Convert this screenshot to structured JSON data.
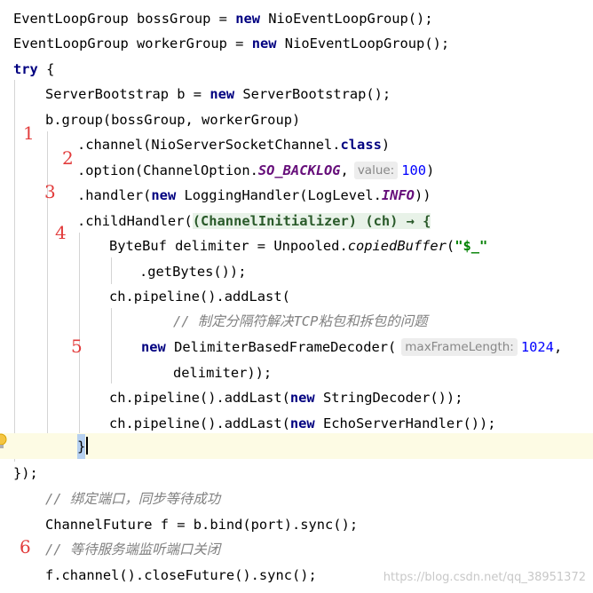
{
  "code": {
    "l1_a": "EventLoopGroup bossGroup = ",
    "kw_new": "new",
    "l1_b": " NioEventLoopGroup();",
    "l2_a": "EventLoopGroup workerGroup = ",
    "l2_b": " NioEventLoopGroup();",
    "kw_try": "try",
    "l3_b": " {",
    "l4_a": "ServerBootstrap b = ",
    "l4_b": " ServerBootstrap();",
    "l5": "b.group(bossGroup, workerGroup)",
    "l6_a": ".channel(NioServerSocketChannel.",
    "kw_class": "class",
    "l6_b": ")",
    "l7_a": ".option(ChannelOption.",
    "l7_field": "SO_BACKLOG",
    "l7_comma": ",",
    "l7_hint": "value:",
    "l7_num": "100",
    "l7_close": ")",
    "l8_a": ".handler(",
    "l8_b": " LoggingHandler(LogLevel.",
    "l8_field": "INFO",
    "l8_close": "))",
    "l9_a": ".childHandler(",
    "l9_lambda": "(ChannelInitializer) (ch) → {",
    "l10_a": "ByteBuf delimiter = Unpooled.",
    "l10_method": "copiedBuffer",
    "l10_paren": "(",
    "l10_str": "\"$_\"",
    "l11": ".getBytes());",
    "l12": "ch.pipeline().addLast(",
    "l13_comment": "// 制定分隔符解决TCP粘包和拆包的问题",
    "l14_b": " DelimiterBasedFrameDecoder(",
    "l14_hint": "maxFrameLength:",
    "l14_num": "1024",
    "l14_comma": ",",
    "l15": "delimiter));",
    "l16_a": "ch.pipeline().addLast(",
    "l16_b": " StringDecoder());",
    "l17_a": "ch.pipeline().addLast(",
    "l17_b": " EchoServerHandler());",
    "l18": "}",
    "l19": "});",
    "l20_comment": "// 绑定端口，同步等待成功",
    "l21": "ChannelFuture f = b.bind(port).sync();",
    "l22_comment": "// 等待服务端监听端口关闭",
    "l23": "f.channel().closeFuture().sync();"
  },
  "markers": [
    "1",
    "2",
    "3",
    "4",
    "5",
    "6"
  ],
  "icons": {
    "intention": "lightbulb-icon"
  },
  "watermark": "https://blog.csdn.net/qq_38951372",
  "colors": {
    "keyword": "#000080",
    "field": "#660e7a",
    "number": "#0000ff",
    "string": "#008000",
    "comment": "#808080",
    "marker": "#e23c3c"
  }
}
